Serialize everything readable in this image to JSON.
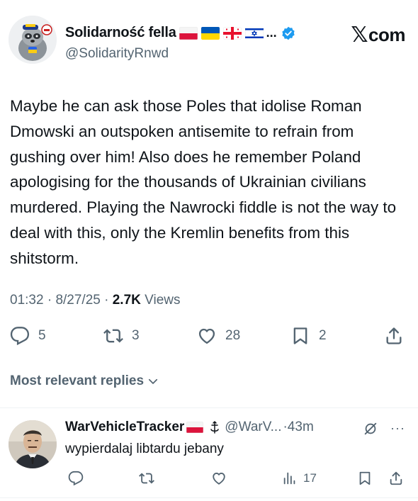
{
  "tweet": {
    "display_name": "Solidarność fella",
    "name_ellipsis": "...",
    "handle": "@SolidarityRnwd",
    "source": "com",
    "text": "Maybe he can ask those Poles that idolise Roman Dmowski an outspoken antisemite to refrain from gushing over him! Also does he remember Poland apologising for the thousands of Ukrainian civilians murdered. Playing the Nawrocki fiddle is not the way to deal with this, only the Kremlin benefits from this shitstorm.",
    "time": "01:32",
    "date": "8/27/25",
    "views_count": "2.7K",
    "views_label": "Views",
    "sep": "·"
  },
  "actions": {
    "replies": "5",
    "reposts": "3",
    "likes": "28",
    "bookmarks": "2"
  },
  "replies_section": {
    "label": "Most relevant replies"
  },
  "reply": {
    "display_name": "WarVehicleTracker",
    "handle": "@WarV...",
    "time": "·43m",
    "more": "···",
    "text": "wypierdalaj libtardu jebany",
    "views": "17"
  },
  "icons": {
    "verified": "verified-badge-icon",
    "reply": "reply-icon",
    "repost": "repost-icon",
    "like": "heart-icon",
    "bookmark": "bookmark-icon",
    "share": "share-icon",
    "views": "views-bar-icon",
    "grok": "grok-icon",
    "more": "more-icon",
    "chevron": "chevron-down-icon"
  },
  "colors": {
    "verified_blue": "#1d9bf0",
    "secondary_text": "#536471",
    "primary_text": "#0f1419"
  }
}
